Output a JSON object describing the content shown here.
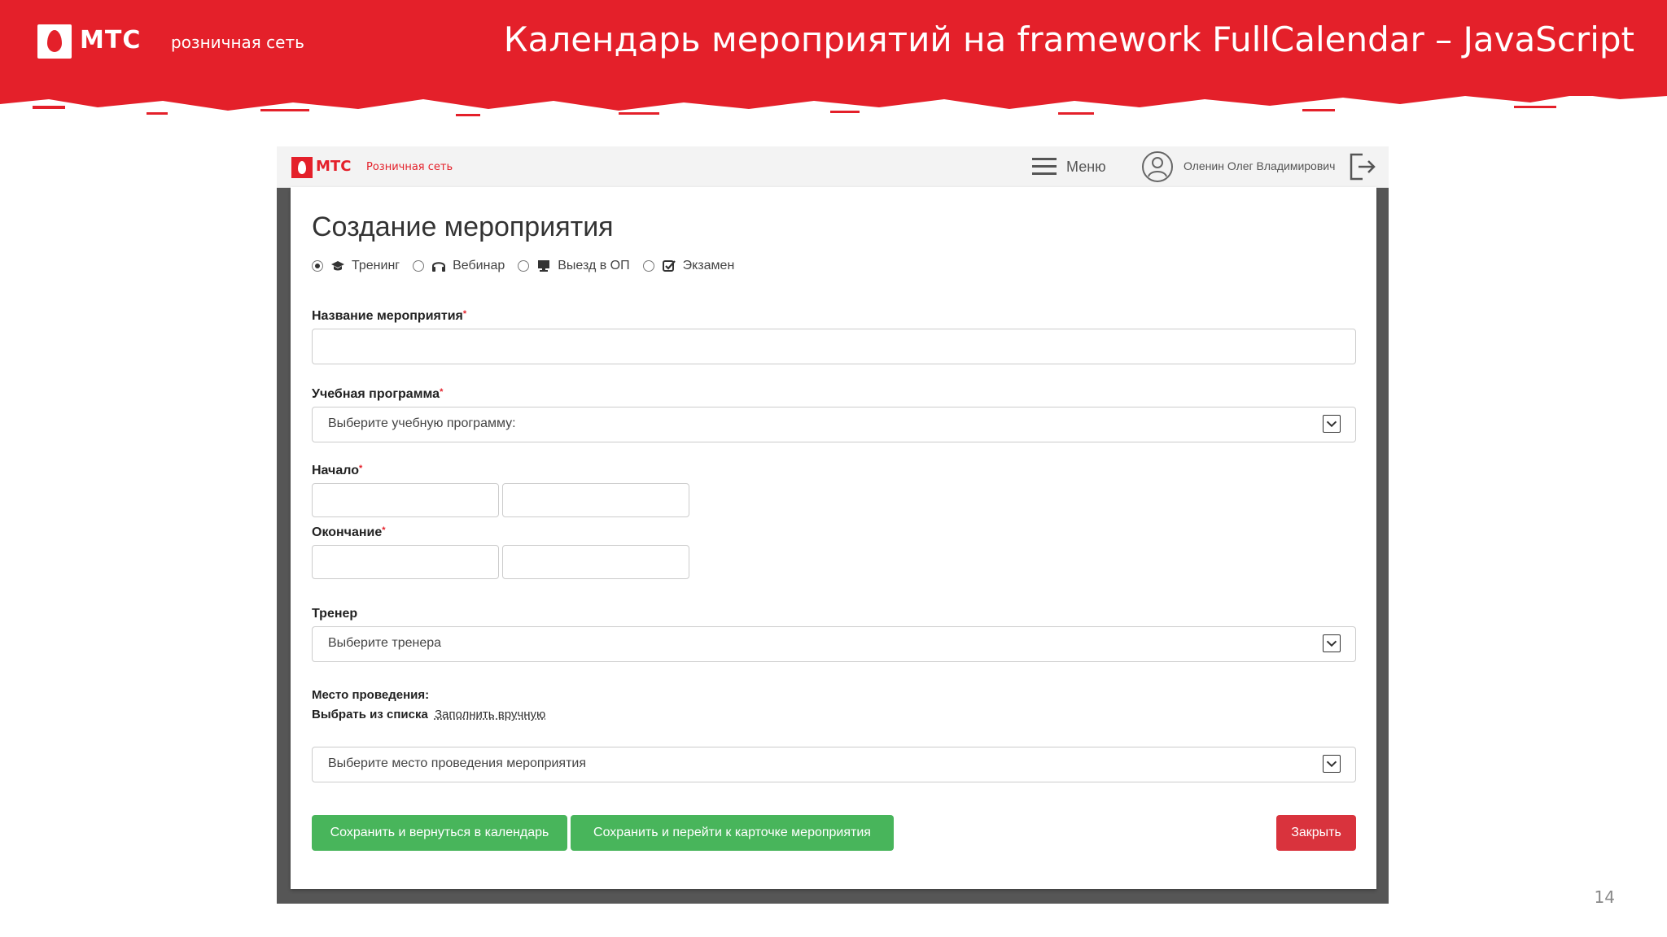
{
  "slide": {
    "brand": "МТС",
    "subbrand": "розничная сеть",
    "title": "Календарь мероприятий на framework FullCalendar – JavaScript",
    "page_number": "14",
    "accent_color": "#e4202a"
  },
  "app": {
    "brand": "МТС",
    "subbrand": "Розничная сеть",
    "menu_label": "Меню",
    "user_name": "Оленин Олег Владимирович"
  },
  "form": {
    "title": "Создание мероприятия",
    "types": [
      {
        "label": "Тренинг",
        "icon": "graduation-cap-icon",
        "checked": true
      },
      {
        "label": "Вебинар",
        "icon": "headphones-icon",
        "checked": false
      },
      {
        "label": "Выезд в ОП",
        "icon": "desktop-icon",
        "checked": false
      },
      {
        "label": "Экзамен",
        "icon": "check-square-icon",
        "checked": false
      }
    ],
    "name_label": "Название мероприятия",
    "name_value": "",
    "program_label": "Учебная программа",
    "program_placeholder": "Выберите учебную программу:",
    "start_label": "Начало",
    "end_label": "Окончание",
    "trainer_label": "Тренер",
    "trainer_placeholder": "Выберите тренера",
    "location_label": "Место проведения:",
    "location_select_text": "Выбрать из списка",
    "location_manual_link": "Заполнить вручную",
    "location_placeholder": "Выберите место проведения мероприятия",
    "required_mark": "*",
    "buttons": {
      "save_return": "Сохранить и вернуться в календарь",
      "save_card": "Сохранить и перейти к карточке мероприятия",
      "close": "Закрыть"
    },
    "colors": {
      "save": "#48b55b",
      "close": "#d9333d"
    }
  }
}
